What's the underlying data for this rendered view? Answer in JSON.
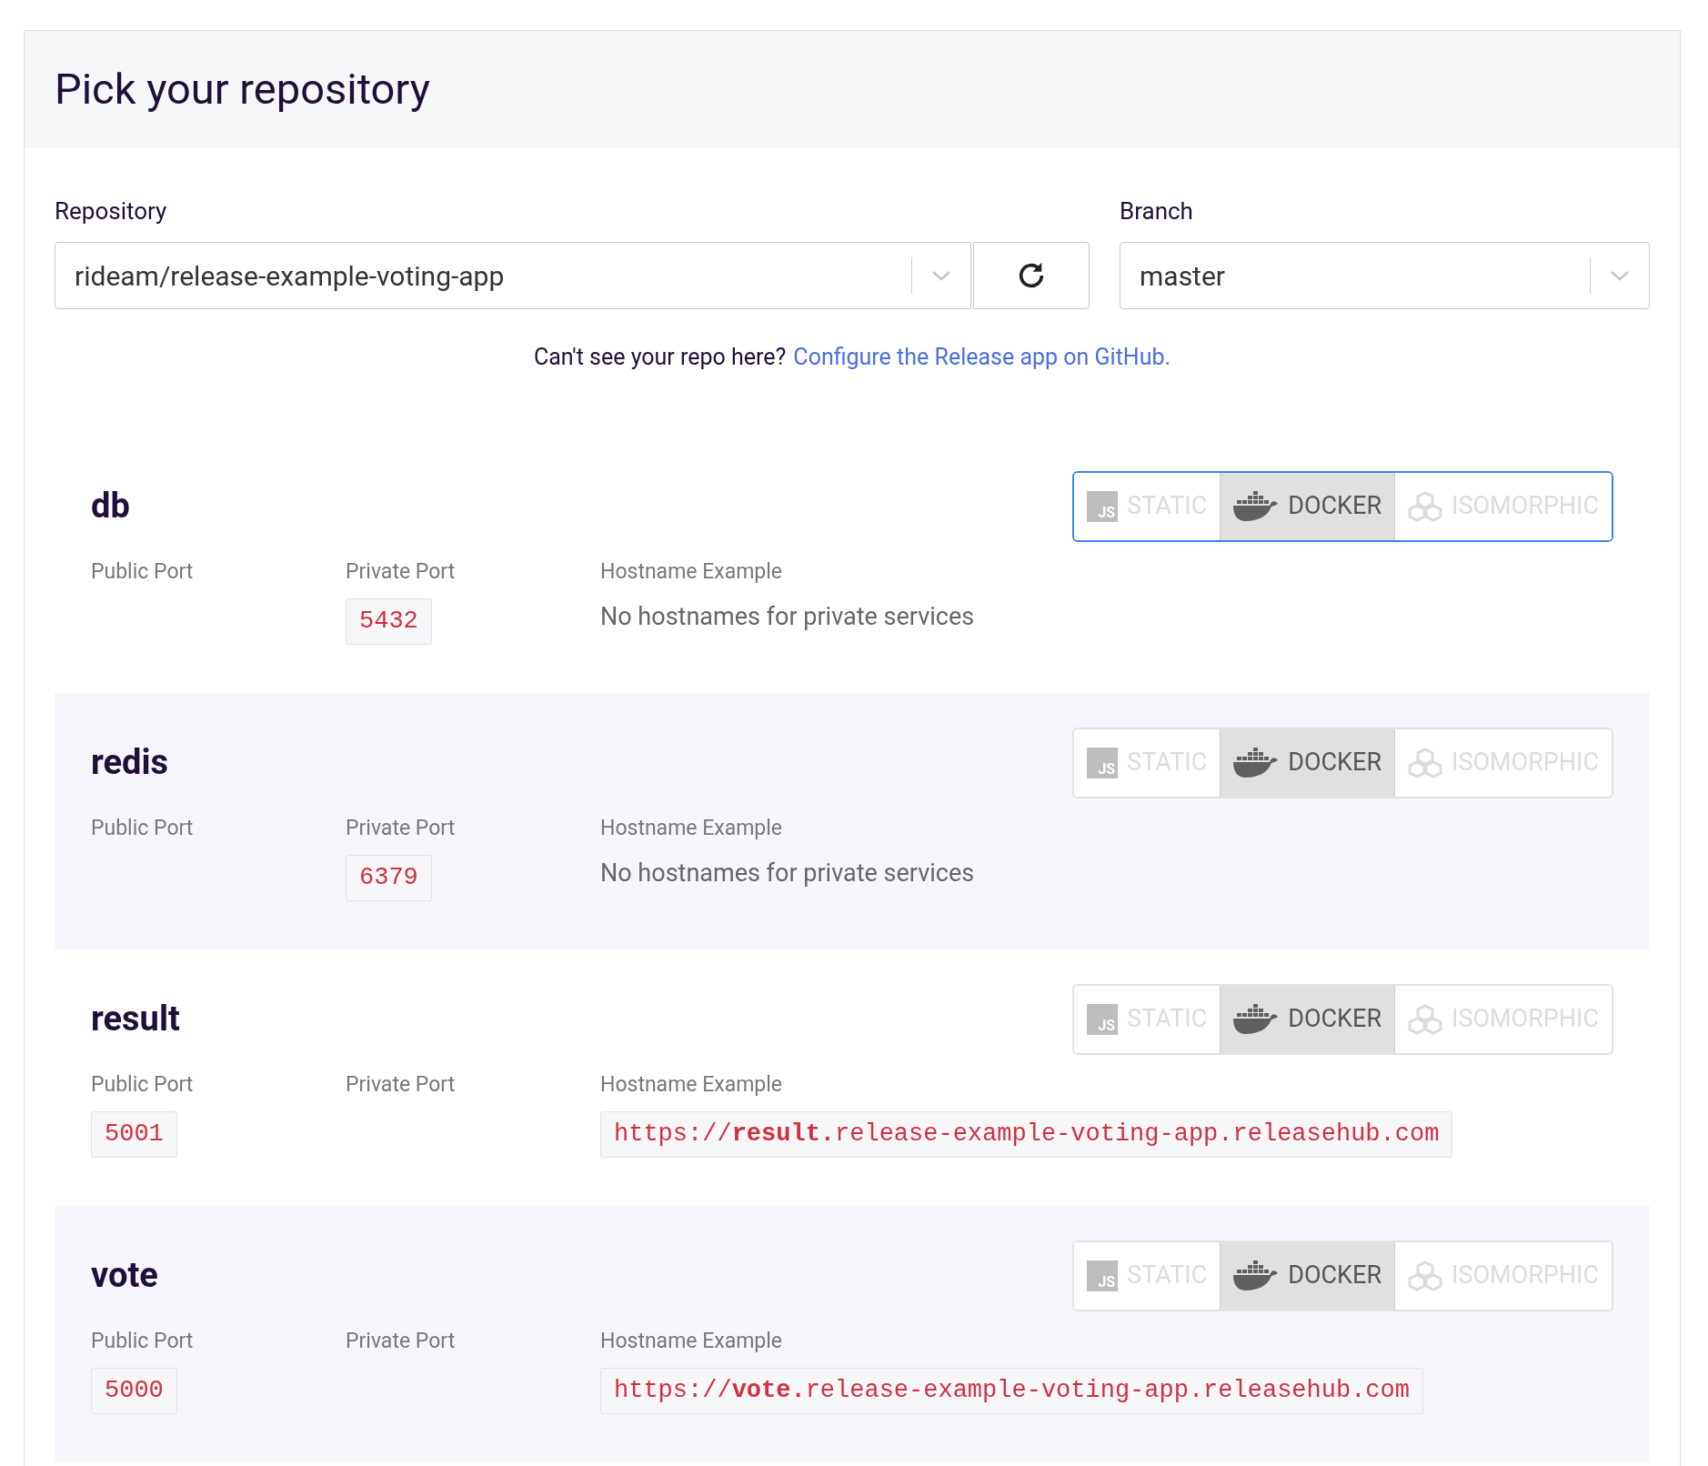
{
  "header": {
    "title": "Pick your repository"
  },
  "repository": {
    "label": "Repository",
    "value": "rideam/release-example-voting-app"
  },
  "branch": {
    "label": "Branch",
    "value": "master"
  },
  "help": {
    "text": "Can't see your repo here?",
    "link": "Configure the Release app on GitHub."
  },
  "services": [
    {
      "name": "db",
      "focused": true,
      "options": [
        {
          "kind": "js",
          "icon_text": "JS",
          "label": "STATIC",
          "selected": false
        },
        {
          "kind": "docker",
          "label": "DOCKER",
          "selected": true
        },
        {
          "kind": "cubes",
          "label": "ISOMORPHIC",
          "selected": false
        }
      ],
      "public_port_label": "Public Port",
      "private_port_label": "Private Port",
      "private_port": "5432",
      "hostname_label": "Hostname Example",
      "hostname": {
        "kind": "note",
        "text": "No hostnames for private services"
      }
    },
    {
      "name": "redis",
      "focused": false,
      "options": [
        {
          "kind": "js",
          "icon_text": "JS",
          "label": "STATIC",
          "selected": false
        },
        {
          "kind": "docker",
          "label": "DOCKER",
          "selected": true
        },
        {
          "kind": "cubes",
          "label": "ISOMORPHIC",
          "selected": false
        }
      ],
      "public_port_label": "Public Port",
      "private_port_label": "Private Port",
      "private_port": "6379",
      "hostname_label": "Hostname Example",
      "hostname": {
        "kind": "note",
        "text": "No hostnames for private services"
      }
    },
    {
      "name": "result",
      "focused": false,
      "options": [
        {
          "kind": "js",
          "icon_text": "JS",
          "label": "STATIC",
          "selected": false
        },
        {
          "kind": "docker",
          "label": "DOCKER",
          "selected": true
        },
        {
          "kind": "cubes",
          "label": "ISOMORPHIC",
          "selected": false
        }
      ],
      "public_port_label": "Public Port",
      "public_port": "5001",
      "private_port_label": "Private Port",
      "hostname_label": "Hostname Example",
      "hostname": {
        "kind": "url",
        "text": "https://**result.**release-example-voting-app.releasehub.com"
      }
    },
    {
      "name": "vote",
      "focused": false,
      "options": [
        {
          "kind": "js",
          "icon_text": "JS",
          "label": "STATIC",
          "selected": false
        },
        {
          "kind": "docker",
          "label": "DOCKER",
          "selected": true
        },
        {
          "kind": "cubes",
          "label": "ISOMORPHIC",
          "selected": false
        }
      ],
      "public_port_label": "Public Port",
      "public_port": "5000",
      "private_port_label": "Private Port",
      "hostname_label": "Hostname Example",
      "hostname": {
        "kind": "url",
        "text": "https://**vote.**release-example-voting-app.releasehub.com"
      }
    }
  ]
}
